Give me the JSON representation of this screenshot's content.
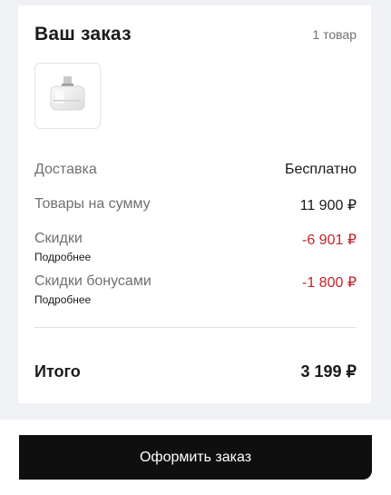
{
  "order": {
    "title": "Ваш заказ",
    "items_count": "1 товар"
  },
  "product": {
    "icon": "perfume-bottle-icon"
  },
  "summary": {
    "delivery": {
      "label": "Доставка",
      "value": "Бесплатно"
    },
    "subtotal": {
      "label": "Товары на сумму",
      "value": "11 900 ₽"
    },
    "discounts": {
      "label": "Скидки",
      "value": "-6 901 ₽",
      "more": "Подробнее"
    },
    "bonus": {
      "label": "Скидки бонусами",
      "value": "-1 800 ₽",
      "more": "Подробнее"
    }
  },
  "total": {
    "label": "Итого",
    "value": "3 199 ₽"
  },
  "checkout": {
    "label": "Оформить заказ"
  },
  "colors": {
    "page_bg": "#f0f1f4",
    "card_bg": "#ffffff",
    "discount_red": "#c4232b",
    "muted_text": "#707070",
    "button_bg": "#0f0f0f"
  }
}
